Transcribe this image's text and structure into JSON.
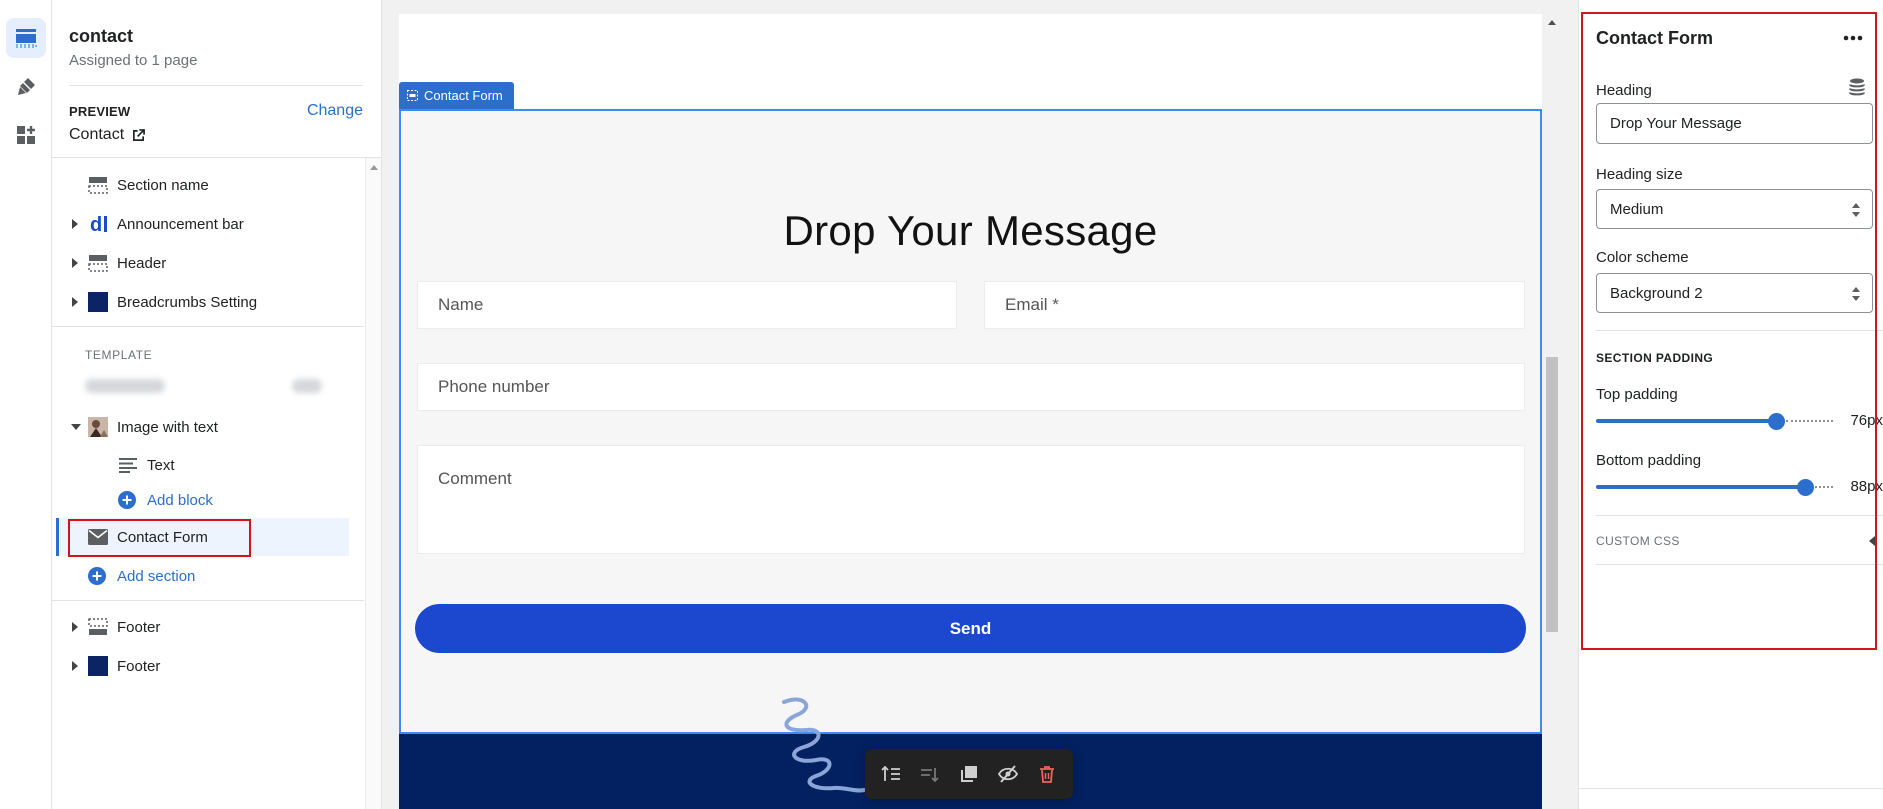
{
  "sidebar": {
    "page_name": "contact",
    "page_sub": "Assigned to 1 page",
    "preview_label": "PREVIEW",
    "preview_change": "Change",
    "preview_value": "Contact",
    "items": [
      {
        "label": "Section name"
      },
      {
        "label": "Announcement bar"
      },
      {
        "label": "Header"
      },
      {
        "label": "Breadcrumbs Setting"
      }
    ],
    "template_label": "TEMPLATE",
    "template_items": [
      {
        "label": "Image with text"
      },
      {
        "label": "Text"
      },
      {
        "label": "Add block"
      },
      {
        "label": "Contact Form"
      },
      {
        "label": "Add section"
      }
    ],
    "footer_items": [
      {
        "label": "Footer"
      },
      {
        "label": "Footer"
      }
    ]
  },
  "canvas": {
    "section_tag": "Contact Form",
    "form": {
      "heading": "Drop Your Message",
      "name_placeholder": "Name",
      "email_placeholder": "Email *",
      "phone_placeholder": "Phone number",
      "comment_placeholder": "Comment",
      "send_label": "Send"
    }
  },
  "settings": {
    "title": "Contact Form",
    "heading_label": "Heading",
    "heading_value": "Drop Your Message",
    "heading_size_label": "Heading size",
    "heading_size_value": "Medium",
    "color_scheme_label": "Color scheme",
    "color_scheme_value": "Background 2",
    "section_padding_label": "SECTION PADDING",
    "top_padding_label": "Top padding",
    "top_padding_value": "76px",
    "top_padding_fraction": 0.76,
    "bottom_padding_label": "Bottom padding",
    "bottom_padding_value": "88px",
    "bottom_padding_fraction": 0.88,
    "custom_css_label": "CUSTOM CSS"
  },
  "colors": {
    "accent": "#2c6ecb",
    "send_button": "#1b48cf",
    "footer_band": "#032161",
    "highlight": "#d4131b"
  }
}
